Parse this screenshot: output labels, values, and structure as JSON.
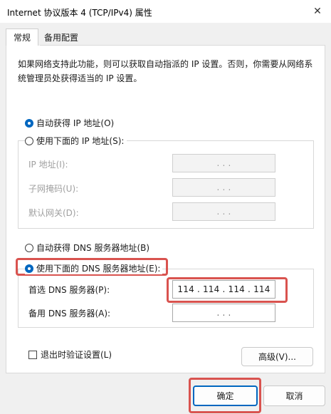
{
  "window": {
    "title": "Internet 协议版本 4 (TCP/IPv4) 属性",
    "close_glyph": "✕"
  },
  "tabs": [
    {
      "label": "常规",
      "active": true
    },
    {
      "label": "备用配置",
      "active": false
    }
  ],
  "description": "如果网络支持此功能，则可以获取自动指派的 IP 设置。否则，你需要从网络系统管理员处获得适当的 IP 设置。",
  "ip_section": {
    "auto_label": "自动获得 IP 地址(O)",
    "manual_label": "使用下面的 IP 地址(S):",
    "auto_selected": true,
    "fields": [
      {
        "label": "IP 地址(I):",
        "value": ".    .    ."
      },
      {
        "label": "子网掩码(U):",
        "value": ".    .    ."
      },
      {
        "label": "默认网关(D):",
        "value": ".    .    ."
      }
    ]
  },
  "dns_section": {
    "auto_label": "自动获得 DNS 服务器地址(B)",
    "manual_label": "使用下面的 DNS 服务器地址(E):",
    "manual_selected": true,
    "preferred_label": "首选 DNS 服务器(P):",
    "preferred_value": "114 . 114 . 114 . 114",
    "alternate_label": "备用 DNS 服务器(A):",
    "alternate_value": ".    .    ."
  },
  "validate_label": "退出时验证设置(L)",
  "advanced_label": "高级(V)...",
  "ok_label": "确定",
  "cancel_label": "取消",
  "colors": {
    "accent": "#0067c0",
    "highlight": "#d9534f"
  }
}
